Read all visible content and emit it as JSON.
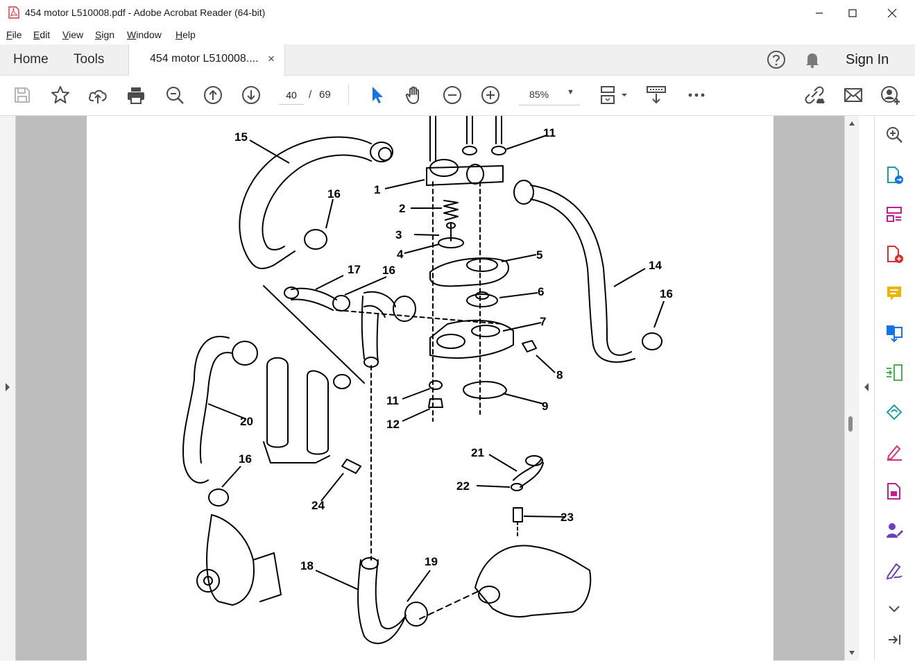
{
  "window": {
    "title": "454 motor L510008.pdf - Adobe Acrobat Reader (64-bit)",
    "controls": [
      "minimize",
      "maximize",
      "close"
    ]
  },
  "menu": [
    "File",
    "Edit",
    "View",
    "Sign",
    "Window",
    "Help"
  ],
  "tabs": {
    "home": "Home",
    "tools": "Tools",
    "document": "454 motor L510008....",
    "close_glyph": "×"
  },
  "header_right": {
    "sign_in": "Sign In",
    "icons": [
      "help-icon",
      "bell-icon"
    ]
  },
  "toolbar": {
    "page_current": "40",
    "page_separator": "/",
    "page_total": "69",
    "zoom": "85%",
    "icons": [
      "save-icon",
      "bookmark-star-icon",
      "cloud-upload-icon",
      "print-icon",
      "zoom-search-icon",
      "page-up-icon",
      "page-down-icon",
      "select-cursor-icon",
      "hand-icon",
      "zoom-out-icon",
      "zoom-in-icon",
      "page-display-icon",
      "scroll-mode-icon",
      "more-icon",
      "share-link-icon",
      "email-icon",
      "add-user-icon"
    ]
  },
  "right_pane": {
    "icons": [
      "zoom-search-icon",
      "export-pdf-icon",
      "organize-pages-icon",
      "create-pdf-icon",
      "comment-icon",
      "combine-files-icon",
      "compress-icon",
      "edit-pdf-icon",
      "fill-sign-icon",
      "protect-icon",
      "request-signature-icon",
      "sign-icon",
      "chevron-down-icon",
      "expand-right-icon"
    ]
  },
  "diagram": {
    "callouts": [
      "15",
      "11",
      "1",
      "16",
      "2",
      "3",
      "4",
      "5",
      "14",
      "17",
      "16",
      "6",
      "16",
      "7",
      "8",
      "20",
      "11",
      "9",
      "12",
      "16",
      "21",
      "22",
      "24",
      "23",
      "18",
      "19"
    ]
  },
  "colors": {
    "accent_blue": "#1473e6",
    "toolbar_icon": "#4b4b4b",
    "tab_bar": "#f0f0f0",
    "doc_background": "#bdbdbd"
  }
}
